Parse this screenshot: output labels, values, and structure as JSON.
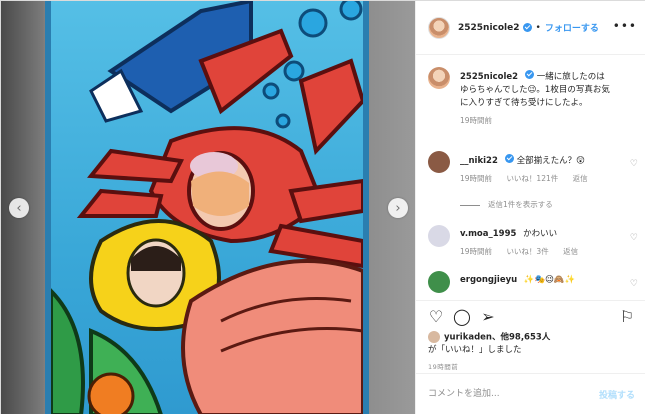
{
  "post": {
    "username": "2525nicole2",
    "follow_label": "フォローする",
    "separator": "•",
    "more_label": "•••"
  },
  "caption": {
    "username": "2525nicole2",
    "text": "一緒に旅したのはゆらちゃんでした😉。1枚目の写真お気に入りすぎて待ち受けにしたよ。",
    "time": "19時間前"
  },
  "comments": [
    {
      "username": "__niki22",
      "text": "全部揃えたん？😲",
      "time": "19時間前",
      "likes": "いいね！121件",
      "reply": "返信",
      "view_replies": "返信1件を表示する",
      "avatar_color": "#8a5a44"
    },
    {
      "username": "v.moa_1995",
      "text": "かわいい",
      "time": "19時間前",
      "likes": "いいね！3件",
      "reply": "返信",
      "avatar_color": "#d9d9e6"
    },
    {
      "username": "ergongjieyu",
      "text": "✨🎭😉🙈✨",
      "avatar_color": "#3f8f4a"
    }
  ],
  "likes": {
    "prefix": "yurikaden、他98,653人",
    "suffix": "が「いいね！」しました"
  },
  "timestamp": "19時間前",
  "add_comment": {
    "placeholder": "コメントを追加...",
    "post_label": "投稿する"
  },
  "icons": [
    "heart-icon",
    "comment-icon",
    "share-icon",
    "bookmark-icon"
  ],
  "colors": {
    "accent": "#3897f0",
    "post_disabled": "#b2dffc"
  }
}
